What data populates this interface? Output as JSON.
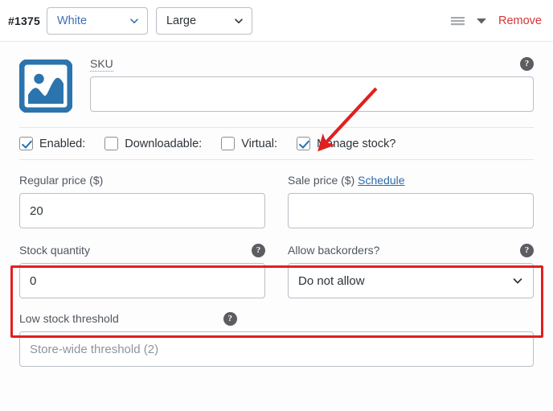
{
  "header": {
    "variation_id": "#1375",
    "attributes": [
      {
        "name": "color-select",
        "value": "White",
        "is_link": true
      },
      {
        "name": "size-select",
        "value": "Large",
        "is_link": false
      }
    ],
    "sort_handle_icon": "hamburger-drag-icon",
    "expand_icon": "chevron-down-icon",
    "remove_label": "Remove"
  },
  "body": {
    "image_placeholder_icon": "image-placeholder-icon",
    "sku": {
      "label": "SKU",
      "value": "",
      "placeholder": "",
      "help_icon": "help-tip-icon",
      "help_glyph": "?"
    },
    "checkboxes": [
      {
        "name": "enabled",
        "label": "Enabled:",
        "checked": true
      },
      {
        "name": "downloadable",
        "label": "Downloadable:",
        "checked": false
      },
      {
        "name": "virtual",
        "label": "Virtual:",
        "checked": false
      },
      {
        "name": "manage-stock",
        "label": "Manage stock?",
        "checked": true
      }
    ],
    "regular_price": {
      "label": "Regular price ($)",
      "value": "20"
    },
    "sale_price": {
      "label": "Sale price ($)",
      "schedule_label": "Schedule",
      "value": ""
    },
    "stock_quantity": {
      "label": "Stock quantity",
      "value": "0",
      "help_glyph": "?"
    },
    "backorders": {
      "label": "Allow backorders?",
      "selected": "Do not allow",
      "help_glyph": "?"
    },
    "low_stock_threshold": {
      "label": "Low stock threshold",
      "value": "",
      "placeholder": "Store-wide threshold (2)",
      "help_glyph": "?"
    }
  },
  "annotations": {
    "arrow": {
      "name": "red-arrow-annotation",
      "color": "#e02020",
      "points_to": "manage-stock-checkbox"
    },
    "highlight": {
      "name": "red-highlight-rectangle",
      "color": "#e02020",
      "surrounds": "stock-quantity-and-backorders-row"
    }
  },
  "colors": {
    "accent_blue": "#2271b1",
    "link_blue": "#2d6ca8",
    "danger_red": "#d63638",
    "annotation_red": "#e02020",
    "label_gray": "#50575e",
    "border_gray": "#b9bfc6"
  }
}
